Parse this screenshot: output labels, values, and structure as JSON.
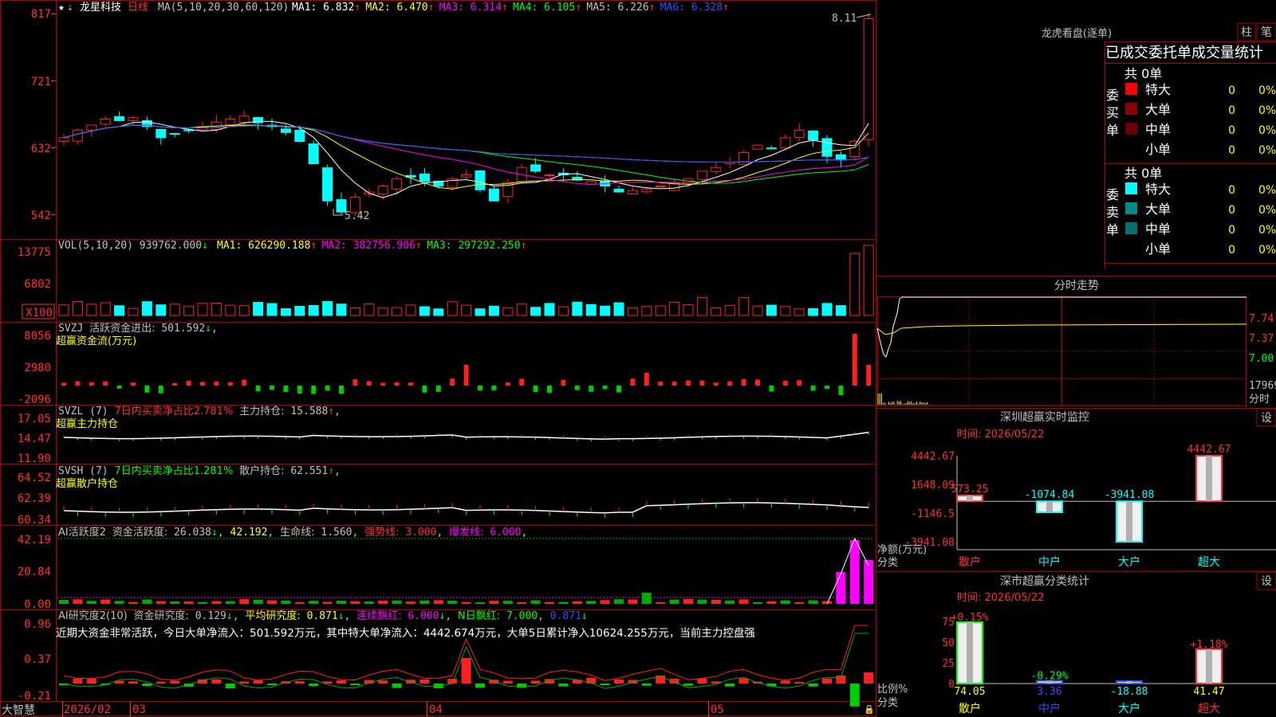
{
  "main": {
    "stock_name": "龙星科技",
    "period": "日线",
    "ma_spec": "MA(5,10,20,30,60,120)",
    "ma": [
      {
        "label": "MA1:",
        "value": "6.832",
        "arrow": "↑",
        "color": "#ffffff"
      },
      {
        "label": "MA2:",
        "value": "6.470",
        "arrow": "↑",
        "color": "#ffff00"
      },
      {
        "label": "MA3:",
        "value": "6.314",
        "arrow": "↑",
        "color": "#ff00ff"
      },
      {
        "label": "MA4:",
        "value": "6.105",
        "arrow": "↑",
        "color": "#00ff00"
      },
      {
        "label": "MA5:",
        "value": "6.226",
        "arrow": "↑",
        "color": "#c0c0c0"
      },
      {
        "label": "MA6:",
        "value": "6.328",
        "arrow": "↑",
        "color": "#3050ff"
      }
    ],
    "y_ticks": [
      "817",
      "721",
      "632",
      "542"
    ],
    "high_label": "8.11",
    "low_label": "5.42"
  },
  "vol": {
    "title": "VOL(5,10,20)",
    "value": "939762.000",
    "arrow": "↓",
    "ma": [
      {
        "label": "MA1:",
        "value": "626290.188",
        "arrow": "↑",
        "color": "#ffff00"
      },
      {
        "label": "MA2:",
        "value": "382756.906",
        "arrow": "↑",
        "color": "#ff00ff"
      },
      {
        "label": "MA3:",
        "value": "297292.250",
        "arrow": "↑",
        "color": "#00ff00"
      }
    ],
    "y_ticks": [
      "13775",
      "6802"
    ],
    "unit": "X100"
  },
  "svzj": {
    "title": "SVZJ",
    "label": "活跃资金进出:",
    "value": "501.592",
    "arrow": "↓",
    "subtitle": "超赢资金流(万元)",
    "y_ticks": [
      "8056",
      "2980",
      "-2096"
    ]
  },
  "svzl": {
    "title": "SVZL (7)",
    "label1": "7日内买卖净占比2.781%",
    "label2": "主力持仓:",
    "value": "15.588",
    "arrow": "↑",
    "subtitle": "超赢主力持仓",
    "y_ticks": [
      "17.05",
      "14.47",
      "11.90"
    ]
  },
  "svsh": {
    "title": "SVSH (7)",
    "label1": "7日内买卖净占比1.281%",
    "label2": "散户持仓:",
    "value": "62.551",
    "arrow": "↑",
    "subtitle": "超赢散户持仓",
    "y_ticks": [
      "64.52",
      "62.39",
      "60.34"
    ]
  },
  "ai1": {
    "title": "AI活跃度2",
    "label": "资金活跃度:",
    "value": "26.038",
    "arrow": "↓",
    "v2": "42.192",
    "life_label": "生命线:",
    "life": "1.560",
    "strong_label": "强势线:",
    "strong": "3.000",
    "burst_label": "爆发线:",
    "burst": "6.000",
    "y_ticks": [
      "42.19",
      "20.84",
      "0.00"
    ]
  },
  "ai2": {
    "title": "AI研究度2(10)",
    "label": "资金研究度:",
    "value": "0.129",
    "avg_label": "平均研究度:",
    "avg": "0.871",
    "cont_label": "连续飘红:",
    "cont": "6.000",
    "n_label": "N日飘红:",
    "n": "7.000",
    "last": "0.871",
    "comment": "近期大资金非常活跃，今日大单净流入：501.592万元，其中特大单净流入：4442.674万元，大单5日累计净入10624.255万元，当前主力控盘强",
    "y_ticks": [
      "0.96",
      "0.37",
      "-0.21"
    ]
  },
  "xaxis": {
    "brand": "大智慧",
    "labels": [
      "2026/02",
      "03",
      "04",
      "05"
    ]
  },
  "dragon": {
    "title": "龙虎看盘(逐单)",
    "btn_bar": "柱",
    "btn_pen": "笔",
    "header": "已成交委托单成交量统计",
    "buy_side": "委买单",
    "sell_side": "委卖单",
    "buy_total": "共 0单",
    "sell_total": "共 0单",
    "buy_rows": [
      {
        "name": "特大",
        "count": "0",
        "pct": "0%",
        "color": "#ff0000"
      },
      {
        "name": "大单",
        "count": "0",
        "pct": "0%",
        "color": "#8b0000"
      },
      {
        "name": "中单",
        "count": "0",
        "pct": "0%",
        "color": "#6b0000"
      },
      {
        "name": "小单",
        "count": "0",
        "pct": "0%",
        "color": "#000000"
      }
    ],
    "sell_rows": [
      {
        "name": "特大",
        "count": "0",
        "pct": "0%",
        "color": "#00ffff"
      },
      {
        "name": "大单",
        "count": "0",
        "pct": "0%",
        "color": "#008b8b"
      },
      {
        "name": "中单",
        "count": "0",
        "pct": "0%",
        "color": "#007070"
      },
      {
        "name": "小单",
        "count": "0",
        "pct": "0%",
        "color": "#000000"
      }
    ]
  },
  "intraday": {
    "title": "分时走势",
    "price_ticks": [
      "7.74",
      "7.37",
      "7.00"
    ],
    "vol_tick": "17969",
    "time_label": "分时"
  },
  "sz_monitor": {
    "title": "深圳超赢实时监控",
    "settings": "设",
    "time": "时间: 2026/05/22",
    "y_ticks": [
      "4442.67",
      "1648.09",
      "-1146.5",
      "-3941.08"
    ],
    "ylabel": "净额(万元)",
    "xlabel": "分类",
    "chart_data": {
      "type": "bar",
      "categories": [
        "散户",
        "中户",
        "大户",
        "超大"
      ],
      "values": [
        573.25,
        -1074.84,
        -3941.08,
        4442.67
      ],
      "value_labels": [
        "573.25",
        "-1074.84",
        "-3941.08",
        "4442.67"
      ],
      "ylim": [
        -3941.08,
        4442.67
      ]
    }
  },
  "sz_class": {
    "title": "深市超赢分类统计",
    "settings": "设",
    "time": "时间: 2026/05/22",
    "y_ticks": [
      "75",
      "50",
      "25",
      "0"
    ],
    "ylabel": "比例%",
    "xlabel": "分类",
    "chart_data": {
      "type": "bar",
      "categories": [
        "散户",
        "中户",
        "大户",
        "超大"
      ],
      "values": [
        74.05,
        3.36,
        -18.88,
        41.47
      ],
      "bottom_labels": [
        "74.05",
        "3.36",
        "-18.88",
        "41.47"
      ],
      "top_labels": [
        "+0.15%",
        "-0.29%",
        "",
        "+1.18%"
      ],
      "ylim": [
        0,
        75
      ]
    }
  }
}
